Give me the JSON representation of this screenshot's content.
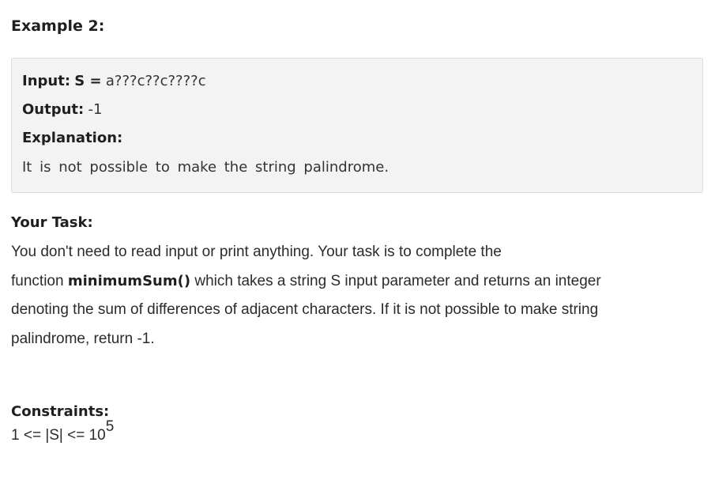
{
  "example": {
    "heading": "Example 2:",
    "input_label": "Input:",
    "input_var": "S =",
    "input_value": "a???c??c????c",
    "output_label": "Output:",
    "output_value": "-1",
    "explanation_label": "Explanation:",
    "explanation_text": "It is not possible to make the string palindrome."
  },
  "task": {
    "heading": "Your Task:",
    "line1": "You don't need to read input or print anything. Your task is to complete the",
    "line2_prefix": "function ",
    "function_name": "minimumSum()",
    "line2_suffix": " which takes a string S input parameter and returns an integer",
    "line3": "denoting the sum of differences of adjacent characters. If it is not possible to make string",
    "line4": "palindrome, return -1."
  },
  "constraints": {
    "heading": "Constraints:",
    "text": "1 <= |S| <= 10",
    "exponent": "5"
  }
}
